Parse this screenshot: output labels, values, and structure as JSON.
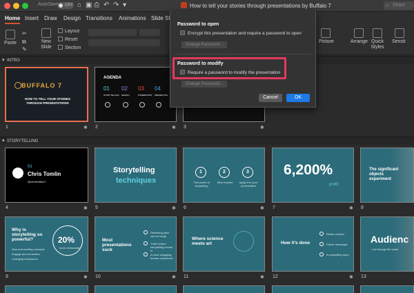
{
  "titlebar": {
    "autosave_label": "AutoSave",
    "autosave_state": "OFF",
    "document_title": "How to tell your stories through presentations by Buffalo 7",
    "search_placeholder": "Searc"
  },
  "tabs": [
    "Home",
    "Insert",
    "Draw",
    "Design",
    "Transitions",
    "Animations",
    "Slide Show"
  ],
  "ribbon": {
    "paste": "Paste",
    "new_slide": "New\nSlide",
    "layout": "Layout",
    "reset": "Reset",
    "section": "Section",
    "picture": "Picture",
    "arrange": "Arrange",
    "quick_styles": "Quick\nStyles",
    "sensitivity": "Sensit"
  },
  "dialog": {
    "open_heading": "Password to open",
    "open_checkbox": "Encrypt this presentation and require a password to open",
    "open_button": "Change Password...",
    "modify_heading": "Password to modify",
    "modify_checkbox": "Require a password to modify the presentation",
    "modify_button": "Change Password...",
    "cancel": "Cancel",
    "ok": "OK"
  },
  "sections": {
    "intro": "INTRO",
    "storytelling": "STORYTELLING"
  },
  "slides": {
    "s1": {
      "num": "1",
      "brand": "BUFFALO 7",
      "title": "HOW TO TELL YOUR STORIES THROUGH PRESENTATIONS"
    },
    "s2": {
      "num": "2",
      "title": "AGENDA",
      "items": [
        "STORYTELLING",
        "DESIGN",
        "POWERPOINT",
        "PRESENTING"
      ],
      "nums": [
        "01",
        "02",
        "03",
        "04"
      ]
    },
    "s3": {
      "num": "3"
    },
    "s4": {
      "num": "4",
      "index": "01",
      "name": "Chris Tomlin",
      "handle": "@chrisbuffalo7"
    },
    "s5": {
      "num": "5",
      "line1": "Storytelling",
      "line2": "techniques"
    },
    "s6": {
      "num": "6",
      "c1": "1",
      "c2": "2",
      "c3": "3",
      "t1": "The power of storytelling",
      "t2": "Why it works",
      "t3": "Apply it to your presentation"
    },
    "s7": {
      "num": "7",
      "big": "6,200%",
      "sub": "profit"
    },
    "s8": {
      "num": "8",
      "text": "The significant objects experiment"
    },
    "s9": {
      "num": "9",
      "title": "Why is storytelling so powerful?",
      "stat": "20%",
      "stat_sub": "more memorable",
      "b1": "New and exciting concepts",
      "b2": "Engage and remember",
      "b3": "Changing behaviours"
    },
    "s10": {
      "num": "10",
      "title": "Most presentations suck",
      "b1": "Delivering data can be tough",
      "b2": "That's where storytelling comes in",
      "b3": "A more engaging, human experience"
    },
    "s11": {
      "num": "11",
      "title": "Where science meets art"
    },
    "s12": {
      "num": "12",
      "title": "How it's done",
      "b1": "Relate content",
      "b2": "Clever messages",
      "b3": "A compelling story"
    },
    "s13": {
      "num": "13",
      "title": "Audienc",
      "sub": "Cut through the noise"
    }
  }
}
